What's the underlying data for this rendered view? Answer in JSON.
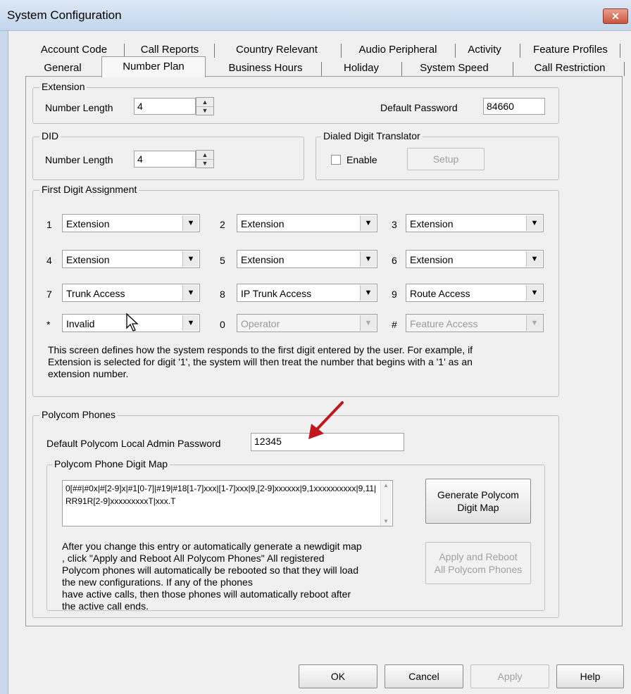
{
  "window": {
    "title": "System Configuration",
    "close_glyph": "✕"
  },
  "tabs_row1": [
    "Account Code",
    "Call Reports",
    "Country Relevant",
    "Audio Peripheral",
    "Activity",
    "Feature Profiles"
  ],
  "tabs_row2": [
    "General",
    "Number Plan",
    "Business Hours",
    "Holiday",
    "System Speed",
    "Call Restriction"
  ],
  "active_tab": "Number Plan",
  "extension": {
    "group_title": "Extension",
    "number_length_label": "Number Length",
    "number_length_value": "4",
    "default_password_label": "Default Password",
    "default_password_value": "84660"
  },
  "did": {
    "group_title": "DID",
    "number_length_label": "Number Length",
    "number_length_value": "4"
  },
  "ddt": {
    "group_title": "Dialed Digit Translator",
    "enable_label": "Enable",
    "enabled": false,
    "setup_label": "Setup"
  },
  "first_digit": {
    "group_title": "First Digit Assignment",
    "rows": [
      [
        {
          "digit": "1",
          "value": "Extension",
          "enabled": true
        },
        {
          "digit": "2",
          "value": "Extension",
          "enabled": true
        },
        {
          "digit": "3",
          "value": "Extension",
          "enabled": true
        }
      ],
      [
        {
          "digit": "4",
          "value": "Extension",
          "enabled": true
        },
        {
          "digit": "5",
          "value": "Extension",
          "enabled": true
        },
        {
          "digit": "6",
          "value": "Extension",
          "enabled": true
        }
      ],
      [
        {
          "digit": "7",
          "value": "Trunk Access",
          "enabled": true
        },
        {
          "digit": "8",
          "value": "IP Trunk Access",
          "enabled": true
        },
        {
          "digit": "9",
          "value": "Route Access",
          "enabled": true
        }
      ],
      [
        {
          "digit": "*",
          "value": "Invalid",
          "enabled": true
        },
        {
          "digit": "0",
          "value": "Operator",
          "enabled": false
        },
        {
          "digit": "#",
          "value": "Feature Access",
          "enabled": false
        }
      ]
    ],
    "description_lines": [
      "This screen defines how the system responds to the first digit entered by the user.  For example, if",
      "Extension is selected for digit '1', the system will then treat the number that begins with a '1' as an",
      "extension number."
    ]
  },
  "polycom": {
    "group_title": "Polycom Phones",
    "admin_password_label": "Default Polycom Local Admin Password",
    "admin_password_value": "12345",
    "digit_map_group_title": "Polycom Phone Digit Map",
    "digit_map_value": "0[##|#0x|#[2-9]x|#1[0-7]|#19|#18[1-7]xxx|[1-7]xxx|9,[2-9]xxxxxx|9,1xxxxxxxxxx|9,11|RR91R[2-9]xxxxxxxxxT|xxx.T",
    "generate_line1": "Generate Polycom",
    "generate_line2": "Digit Map",
    "apply_reboot_line1": "Apply and Reboot",
    "apply_reboot_line2": "All Polycom Phones",
    "info_lines": [
      "After you change this entry or automatically generate a newdigit map",
      ", click \"Apply and Reboot All Polycom Phones\" All registered",
      "Polycom phones will automatically be rebooted so that they will load",
      "the new configurations. If any of the phones",
      "have active calls, then those phones will automatically reboot after",
      "the active call ends."
    ]
  },
  "buttons": {
    "ok": "OK",
    "cancel": "Cancel",
    "apply": "Apply",
    "help": "Help"
  },
  "colors": {
    "annotation_arrow": "#c0161c",
    "title_bar": "#c4d6ec"
  }
}
